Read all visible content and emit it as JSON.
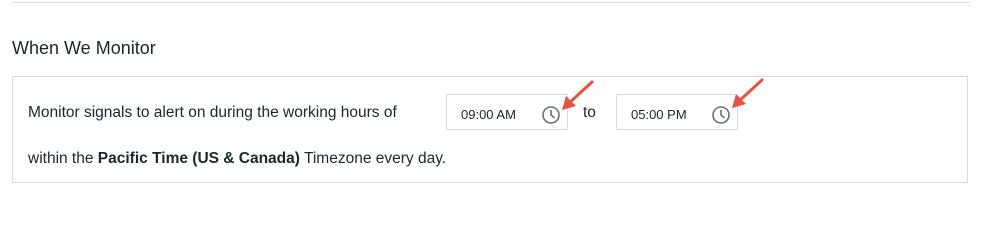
{
  "section": {
    "title": "When We Monitor"
  },
  "schedule": {
    "intro_text": "Monitor signals to alert on during the working hours of",
    "start_time": "09:00 AM",
    "connector": "to",
    "end_time": "05:00 PM",
    "line2_prefix": "within the",
    "timezone": "Pacific Time (US & Canada)",
    "line2_suffix": "Timezone every day."
  },
  "icons": {
    "time_picker": "clock-icon",
    "annotation": "arrow-annotation-icon"
  },
  "colors": {
    "annotation_arrow": "#e5533d",
    "border": "#dcdcdc",
    "text": "#22272b",
    "clock_icon": "#6b7075"
  }
}
